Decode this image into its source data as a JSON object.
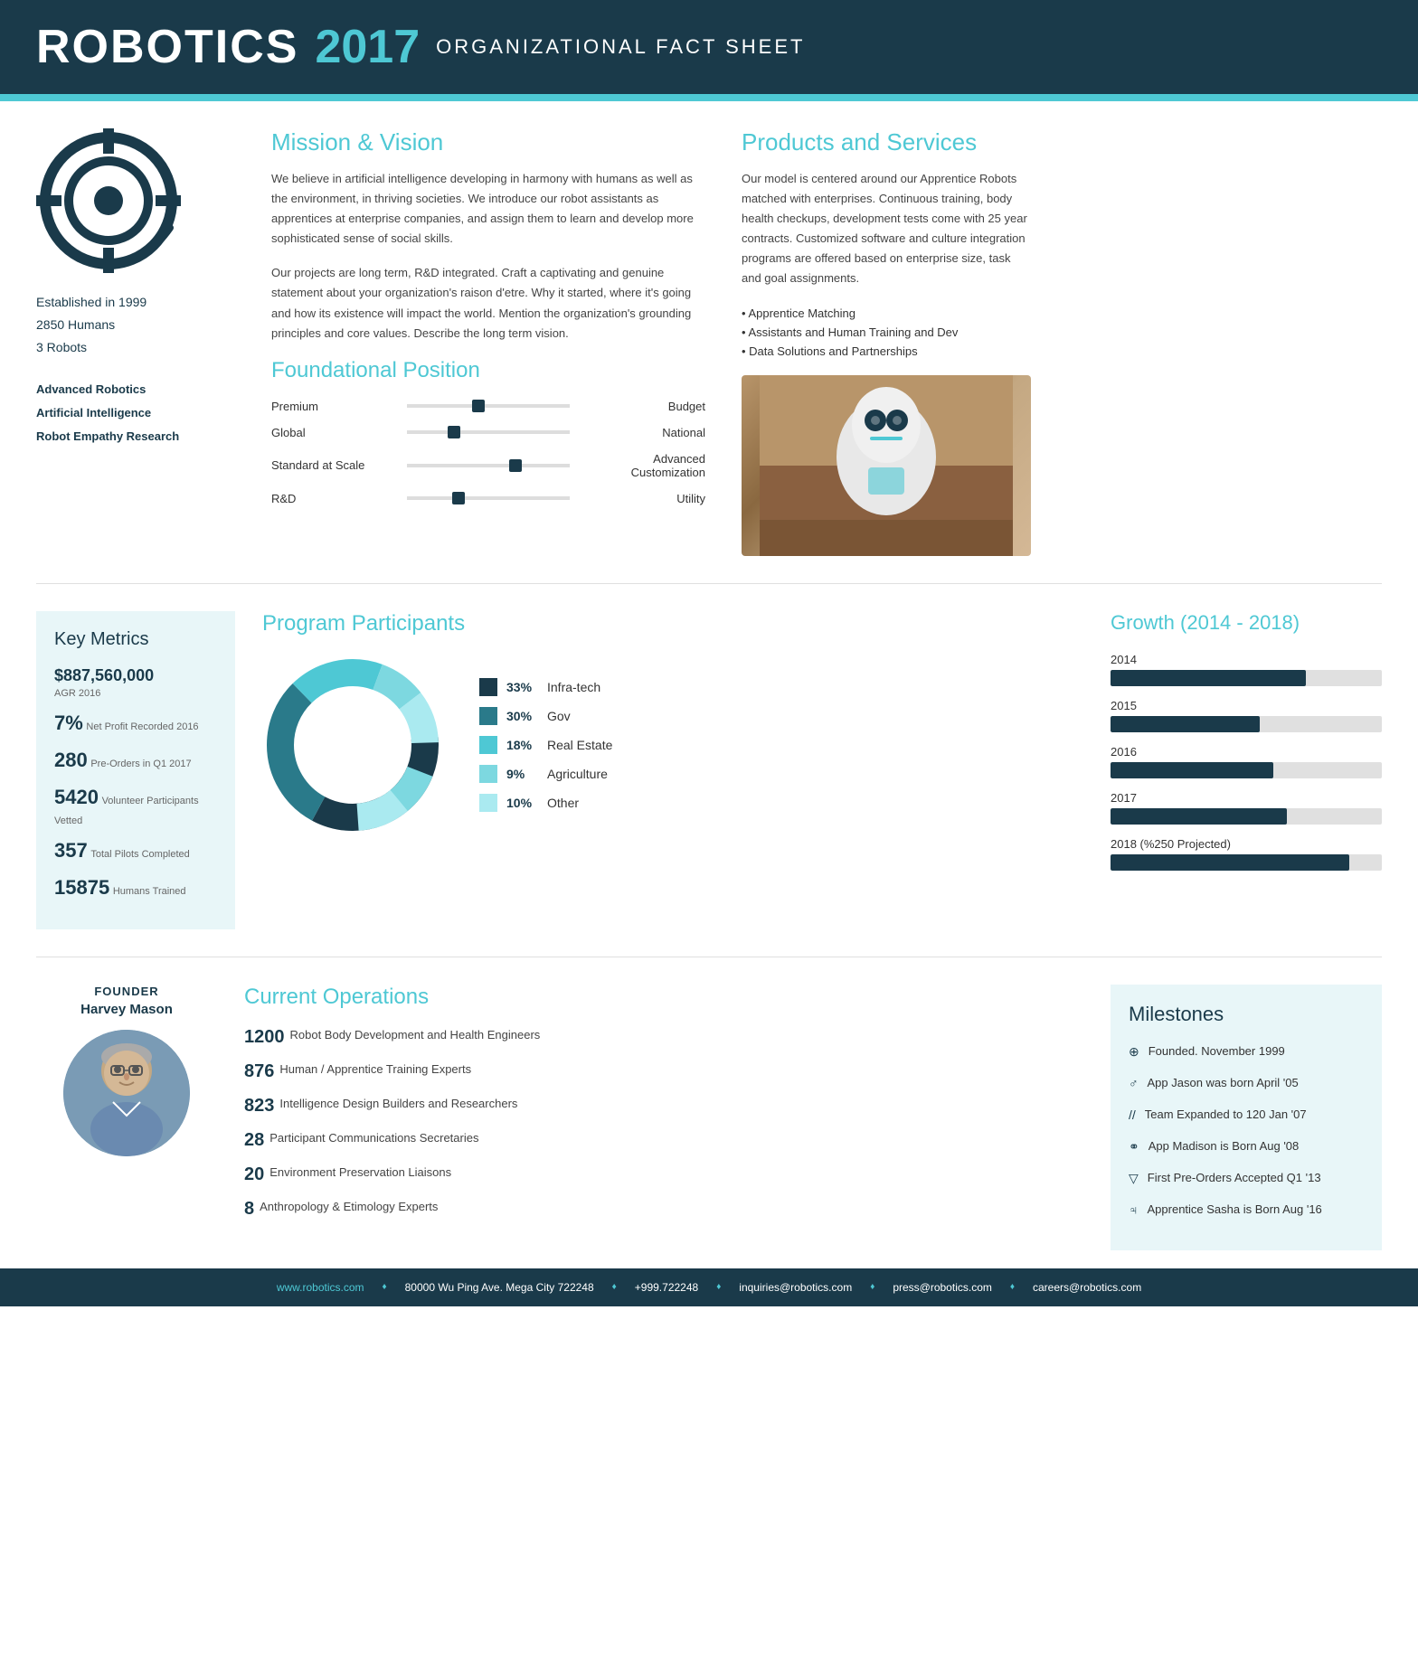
{
  "header": {
    "brand": "ROBOTICS",
    "year": "2017",
    "subtitle": "ORGANIZATIONAL FACT SHEET"
  },
  "orgInfo": {
    "established": "Established in 1999",
    "humans": "2850 Humans",
    "robots": "3 Robots",
    "tags": [
      "Advanced Robotics",
      "Artificial Intelligence",
      "Robot Empathy Research"
    ]
  },
  "mission": {
    "title": "Mission & Vision",
    "para1": "We believe in artificial intelligence developing in harmony with humans as well as the environment, in thriving societies. We introduce our robot assistants as apprentices at enterprise companies, and assign them to learn and develop more sophisticated sense of social skills.",
    "para2": "Our projects are long term, R&D integrated. Craft a captivating and genuine statement about your organization's raison d'etre. Why it started, where it's going and how its existence will impact the world. Mention the organization's grounding principles and core values. Describe the long term vision."
  },
  "foundational": {
    "title": "Foundational Position",
    "sliders": [
      {
        "left": "Premium",
        "right": "Budget",
        "position": 0.42
      },
      {
        "left": "Global",
        "right": "National",
        "position": 0.27
      },
      {
        "left": "Standard at Scale",
        "right": "Advanced Customization",
        "position": 0.65
      },
      {
        "left": "R&D",
        "right": "Utility",
        "position": 0.3
      }
    ]
  },
  "products": {
    "title": "Products and Services",
    "text": "Our model is centered around our Apprentice Robots matched with enterprises. Continuous training, body health checkups, development tests come with 25 year contracts. Customized software and culture integration programs are offered based on enterprise size, task and goal assignments.",
    "list": [
      "Apprentice Matching",
      "Assistants and Human Training and Dev",
      "Data Solutions and Partnerships"
    ]
  },
  "keyMetrics": {
    "title": "Key Metrics",
    "items": [
      {
        "value": "$887,560,000",
        "label": "AGR 2016",
        "large": true
      },
      {
        "value": "7%",
        "label": "Net Profit Recorded 2016"
      },
      {
        "value": "280",
        "label": "Pre-Orders in Q1 2017"
      },
      {
        "value": "5420",
        "label": "Volunteer Participants Vetted"
      },
      {
        "value": "357",
        "label": "Total Pilots Completed"
      },
      {
        "value": "15875",
        "label": "Humans Trained"
      }
    ]
  },
  "programParticipants": {
    "title": "Program Participants",
    "segments": [
      {
        "label": "Infra-tech",
        "pct": 33,
        "color": "#1a3a4a"
      },
      {
        "label": "Gov",
        "pct": 30,
        "color": "#2a7a8a"
      },
      {
        "label": "Real Estate",
        "pct": 18,
        "color": "#4ec8d4"
      },
      {
        "label": "Agriculture",
        "pct": 9,
        "color": "#7dd8e0"
      },
      {
        "label": "Other",
        "pct": 10,
        "color": "#aaeaf0"
      }
    ]
  },
  "growth": {
    "title": "Growth (2014 - 2018)",
    "years": [
      {
        "year": "2014",
        "pct": 72
      },
      {
        "year": "2015",
        "pct": 55
      },
      {
        "year": "2016",
        "pct": 60
      },
      {
        "year": "2017",
        "pct": 65
      },
      {
        "year": "2018 (%250 Projected)",
        "pct": 88
      }
    ]
  },
  "founder": {
    "label": "FOUNDER",
    "name": "Harvey Mason"
  },
  "operations": {
    "title": "Current Operations",
    "items": [
      {
        "num": "1200",
        "desc": "Robot Body Development and Health Engineers"
      },
      {
        "num": "876",
        "desc": "Human / Apprentice Training Experts"
      },
      {
        "num": "823",
        "desc": "Intelligence Design Builders and Researchers"
      },
      {
        "num": "28",
        "desc": "Participant Communications Secretaries"
      },
      {
        "num": "20",
        "desc": "Environment Preservation Liaisons"
      },
      {
        "num": "8",
        "desc": "Anthropology & Etimology Experts"
      }
    ]
  },
  "milestones": {
    "title": "Milestones",
    "items": [
      {
        "icon": "⊕",
        "text": "Founded. November 1999"
      },
      {
        "icon": "♂",
        "text": "App Jason was born April '05"
      },
      {
        "icon": "//",
        "text": "Team Expanded to 120 Jan '07"
      },
      {
        "icon": "♂°",
        "text": "App Madison is Born Aug '08"
      },
      {
        "icon": "▽",
        "text": "First Pre-Orders Accepted Q1 '13"
      },
      {
        "icon": "♃",
        "text": "Apprentice Sasha is Born Aug '16"
      }
    ]
  },
  "footer": {
    "website": "www.robotics.com",
    "address": "80000 Wu Ping Ave. Mega City 722248",
    "phone": "+999.722248",
    "email1": "inquiries@robotics.com",
    "email2": "press@robotics.com",
    "email3": "careers@robotics.com"
  }
}
